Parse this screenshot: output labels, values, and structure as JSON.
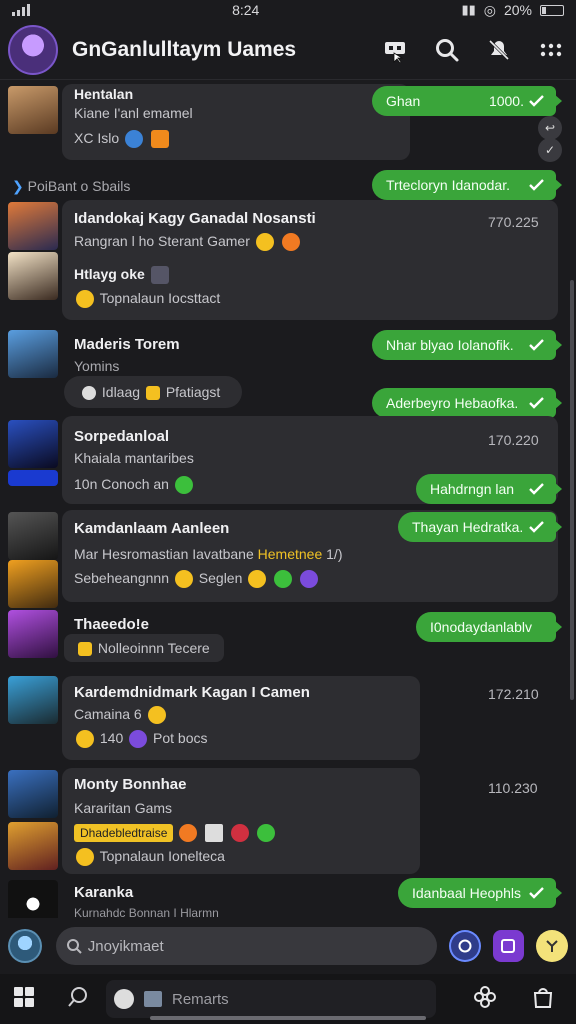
{
  "status": {
    "time": "8:24",
    "battery": "20%"
  },
  "header": {
    "title": "GnGanlulltaym Uames"
  },
  "chats": [
    {
      "name": "Hentalan",
      "line1": "Kiane I'anl emamel",
      "line2": "XC Islo",
      "pill": "Ghan",
      "pill_time": "1000."
    },
    {
      "section": "PoiBant o Sbails",
      "pill": "Trtecloryn Idanodar."
    },
    {
      "name": "Idandokaj Kagy Ganadal Nosansti",
      "time": "770.225",
      "line1": "Rangran l ho Sterant Gamer",
      "line2": "Htlayg oke",
      "line3": "Topnalaun Iocsttact"
    },
    {
      "name": "Maderis Torem",
      "line1": "Yomins",
      "action": "Idlaag",
      "action2": "Pfatiagst",
      "pill": "Nhar blyao Iolanofik.",
      "pill2": "Aderbeyro Hebaofka."
    },
    {
      "name": "Sorpedanloal",
      "time": "170.220",
      "line1": "Khaiala mantaribes",
      "line2": "10n Conoch an",
      "pill": "Hahdrngn lan"
    },
    {
      "name": "Kamdanlaam Aanleen",
      "line1": "Mar Hesromastian Iavatbane",
      "tag": "Hemetnee",
      "tag_num": "1/)",
      "line2": "Sebeheangnnn",
      "line2b": "Seglen",
      "pill": "Thayan Hedratka."
    },
    {
      "name": "Thaeedo!e",
      "line1": "Nolleoinnn Tecere",
      "pill": "I0nodaydanlablv"
    },
    {
      "name": "Kardemdnidmark Kagan I Camen",
      "time": "172.210",
      "line1": "Camaina",
      "line1b": "6",
      "line2": "140",
      "line2b": "Pot bocs"
    },
    {
      "name": "Monty Bonnhae",
      "time": "110.230",
      "line1": "Kararitan Gams",
      "tag": "Dhadebledtraise",
      "line3": "Topnalaun Ionelteca"
    },
    {
      "name": "Karanka",
      "line1": "Kurnahdc Bonnan I Hlarmn",
      "pill": "Idanbaal Heophls"
    }
  ],
  "input": {
    "placeholder": "Jnoyikmaet"
  },
  "nav": {
    "tab_label": "Remarts"
  }
}
